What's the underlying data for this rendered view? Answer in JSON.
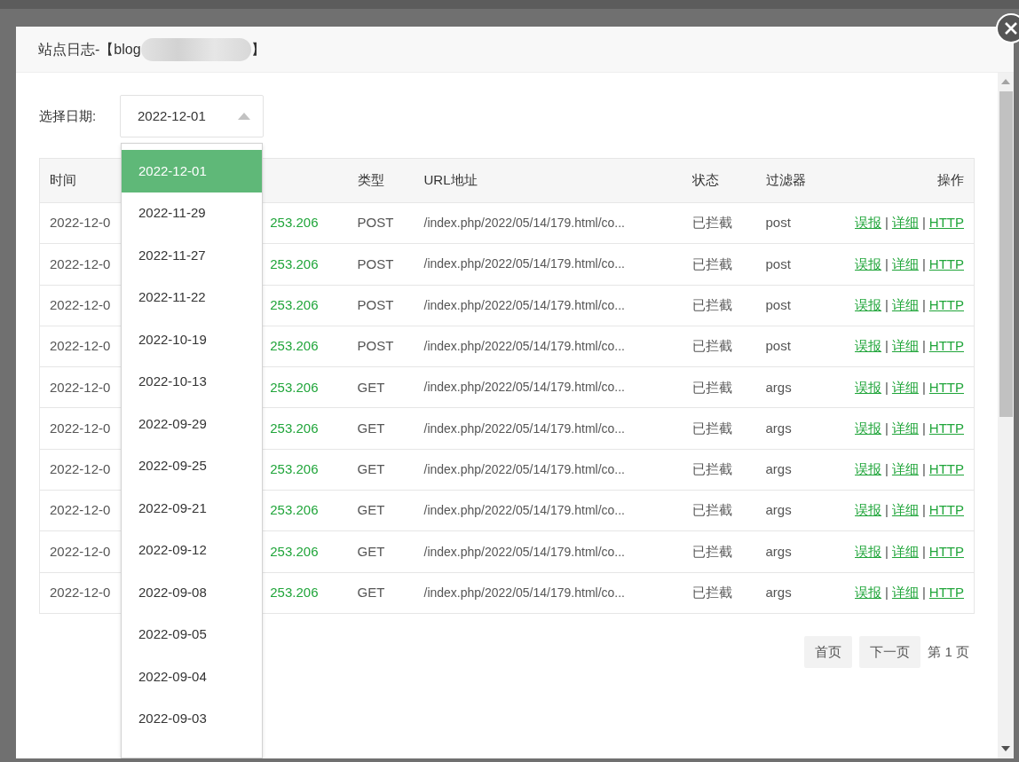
{
  "dialog": {
    "title_start": "站点日志-【blog",
    "title_end": "】"
  },
  "date_filter": {
    "label": "选择日期:",
    "value": "2022-12-01",
    "expanded": true,
    "options": [
      {
        "text": "2022-12-01",
        "selected": true
      },
      {
        "text": "2022-11-29",
        "selected": false
      },
      {
        "text": "2022-11-27",
        "selected": false
      },
      {
        "text": "2022-11-22",
        "selected": false
      },
      {
        "text": "2022-10-19",
        "selected": false
      },
      {
        "text": "2022-10-13",
        "selected": false
      },
      {
        "text": "2022-09-29",
        "selected": false
      },
      {
        "text": "2022-09-25",
        "selected": false
      },
      {
        "text": "2022-09-21",
        "selected": false
      },
      {
        "text": "2022-09-12",
        "selected": false
      },
      {
        "text": "2022-09-08",
        "selected": false
      },
      {
        "text": "2022-09-05",
        "selected": false
      },
      {
        "text": "2022-09-04",
        "selected": false
      },
      {
        "text": "2022-09-03",
        "selected": false
      }
    ]
  },
  "table": {
    "headers": [
      "时间",
      "类型",
      "URL地址",
      "状态",
      "过滤器",
      "操作"
    ],
    "rows": [
      {
        "time": "2022-12-0",
        "ip": "253.206",
        "type": "POST",
        "url": "/index.php/2022/05/14/179.html/co...",
        "status": "已拦截",
        "filter": "post",
        "actions": [
          {
            "kind": "link",
            "text": "误报"
          },
          {
            "kind": "separator",
            "text": "|"
          },
          {
            "kind": "link",
            "text": "详细"
          },
          {
            "kind": "separator",
            "text": "|"
          },
          {
            "kind": "link",
            "text": "HTTP"
          }
        ]
      },
      {
        "time": "2022-12-0",
        "ip": "253.206",
        "type": "POST",
        "url": "/index.php/2022/05/14/179.html/co...",
        "status": "已拦截",
        "filter": "post",
        "actions": [
          {
            "kind": "link",
            "text": "误报"
          },
          {
            "kind": "separator",
            "text": "|"
          },
          {
            "kind": "link",
            "text": "详细"
          },
          {
            "kind": "separator",
            "text": "|"
          },
          {
            "kind": "link",
            "text": "HTTP"
          }
        ]
      },
      {
        "time": "2022-12-0",
        "ip": "253.206",
        "type": "POST",
        "url": "/index.php/2022/05/14/179.html/co...",
        "status": "已拦截",
        "filter": "post",
        "actions": [
          {
            "kind": "link",
            "text": "误报"
          },
          {
            "kind": "separator",
            "text": "|"
          },
          {
            "kind": "link",
            "text": "详细"
          },
          {
            "kind": "separator",
            "text": "|"
          },
          {
            "kind": "link",
            "text": "HTTP"
          }
        ]
      },
      {
        "time": "2022-12-0",
        "ip": "253.206",
        "type": "POST",
        "url": "/index.php/2022/05/14/179.html/co...",
        "status": "已拦截",
        "filter": "post",
        "actions": [
          {
            "kind": "link",
            "text": "误报"
          },
          {
            "kind": "separator",
            "text": "|"
          },
          {
            "kind": "link",
            "text": "详细"
          },
          {
            "kind": "separator",
            "text": "|"
          },
          {
            "kind": "link",
            "text": "HTTP"
          }
        ]
      },
      {
        "time": "2022-12-0",
        "ip": "253.206",
        "type": "GET",
        "url": "/index.php/2022/05/14/179.html/co...",
        "status": "已拦截",
        "filter": "args",
        "actions": [
          {
            "kind": "link",
            "text": "误报"
          },
          {
            "kind": "separator",
            "text": "|"
          },
          {
            "kind": "link",
            "text": "详细"
          },
          {
            "kind": "separator",
            "text": "|"
          },
          {
            "kind": "link",
            "text": "HTTP"
          }
        ]
      },
      {
        "time": "2022-12-0",
        "ip": "253.206",
        "type": "GET",
        "url": "/index.php/2022/05/14/179.html/co...",
        "status": "已拦截",
        "filter": "args",
        "actions": [
          {
            "kind": "link",
            "text": "误报"
          },
          {
            "kind": "separator",
            "text": "|"
          },
          {
            "kind": "link",
            "text": "详细"
          },
          {
            "kind": "separator",
            "text": "|"
          },
          {
            "kind": "link",
            "text": "HTTP"
          }
        ]
      },
      {
        "time": "2022-12-0",
        "ip": "253.206",
        "type": "GET",
        "url": "/index.php/2022/05/14/179.html/co...",
        "status": "已拦截",
        "filter": "args",
        "actions": [
          {
            "kind": "link",
            "text": "误报"
          },
          {
            "kind": "separator",
            "text": "|"
          },
          {
            "kind": "link",
            "text": "详细"
          },
          {
            "kind": "separator",
            "text": "|"
          },
          {
            "kind": "link",
            "text": "HTTP"
          }
        ]
      },
      {
        "time": "2022-12-0",
        "ip": "253.206",
        "type": "GET",
        "url": "/index.php/2022/05/14/179.html/co...",
        "status": "已拦截",
        "filter": "args",
        "actions": [
          {
            "kind": "link",
            "text": "误报"
          },
          {
            "kind": "separator",
            "text": "|"
          },
          {
            "kind": "link",
            "text": "详细"
          },
          {
            "kind": "separator",
            "text": "|"
          },
          {
            "kind": "link",
            "text": "HTTP"
          }
        ]
      },
      {
        "time": "2022-12-0",
        "ip": "253.206",
        "type": "GET",
        "url": "/index.php/2022/05/14/179.html/co...",
        "status": "已拦截",
        "filter": "args",
        "actions": [
          {
            "kind": "link",
            "text": "误报"
          },
          {
            "kind": "separator",
            "text": "|"
          },
          {
            "kind": "link",
            "text": "详细"
          },
          {
            "kind": "separator",
            "text": "|"
          },
          {
            "kind": "link",
            "text": "HTTP"
          }
        ]
      },
      {
        "time": "2022-12-0",
        "ip": "253.206",
        "type": "GET",
        "url": "/index.php/2022/05/14/179.html/co...",
        "status": "已拦截",
        "filter": "args",
        "actions": [
          {
            "kind": "link",
            "text": "误报"
          },
          {
            "kind": "separator",
            "text": "|"
          },
          {
            "kind": "link",
            "text": "详细"
          },
          {
            "kind": "separator",
            "text": "|"
          },
          {
            "kind": "link",
            "text": "HTTP"
          }
        ]
      }
    ]
  },
  "pagination": {
    "buttons": [
      "首页",
      "下一页"
    ],
    "page_label": "第 1 页"
  }
}
